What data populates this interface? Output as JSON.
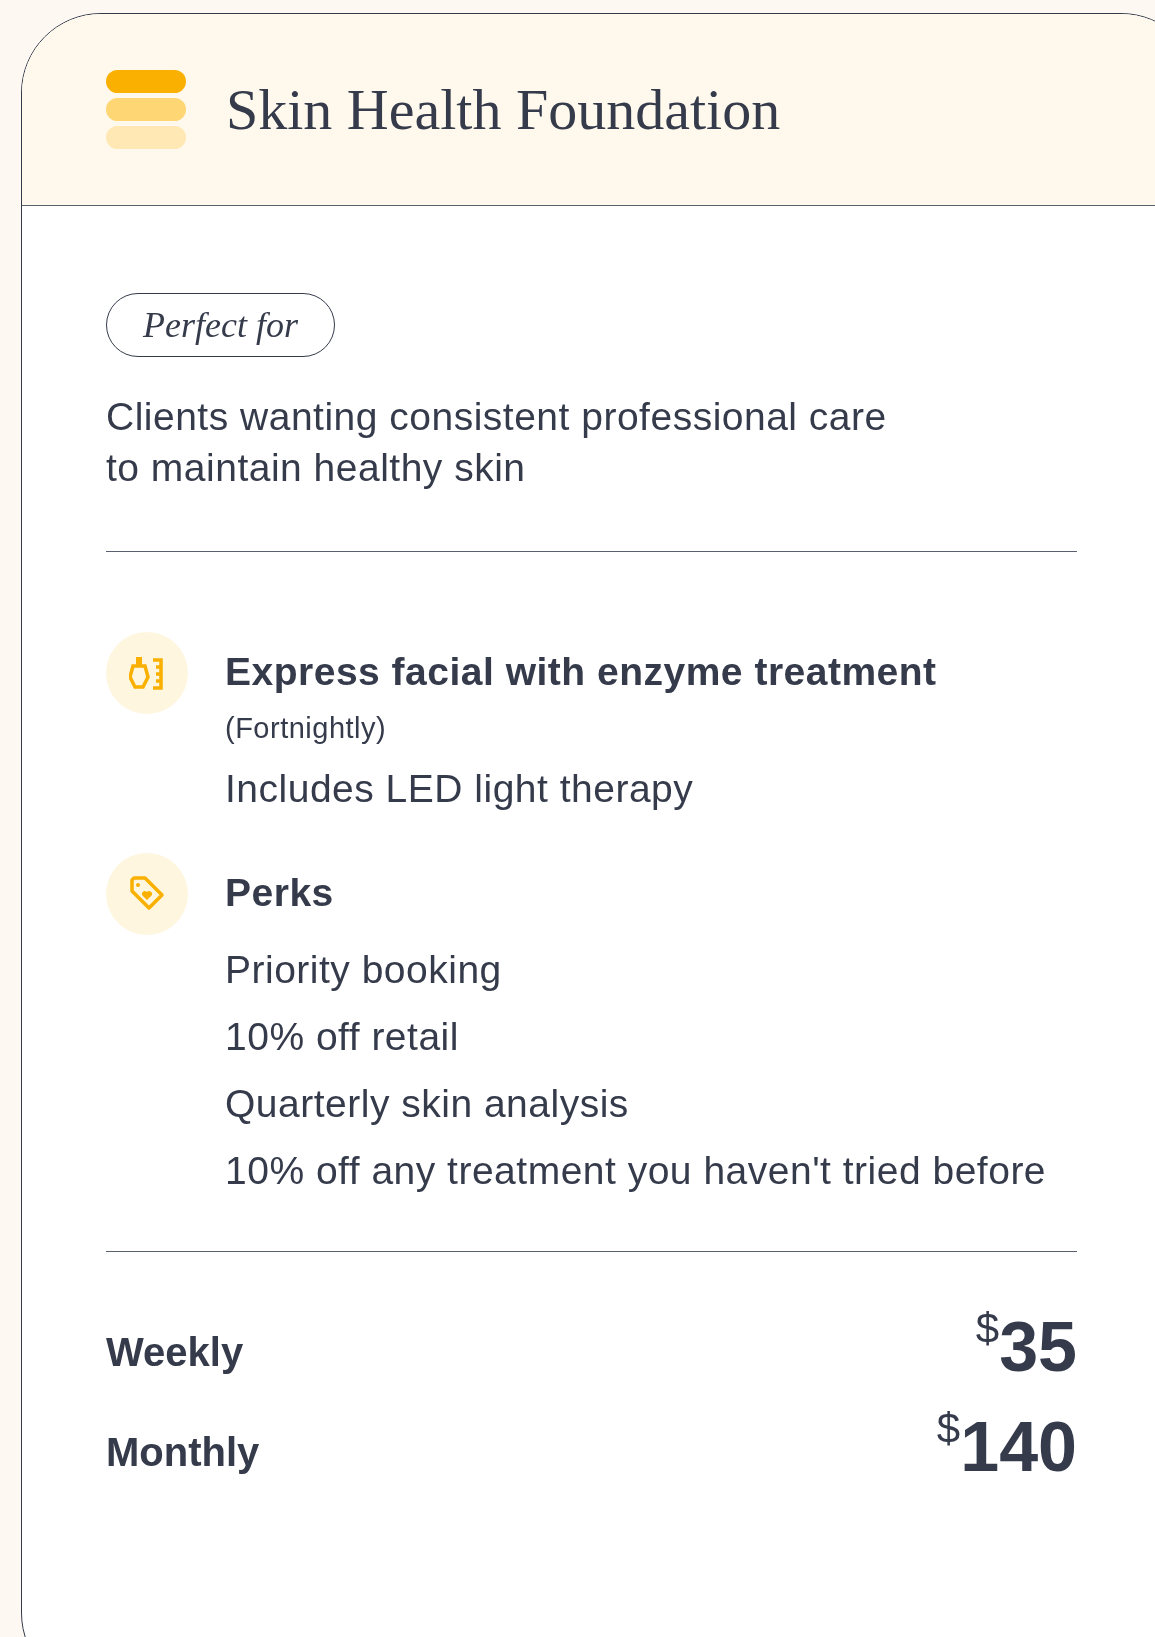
{
  "header": {
    "title": "Skin Health Foundation"
  },
  "audience": {
    "tag": "Perfect for",
    "description": "Clients wanting consistent professional care to maintain healthy skin"
  },
  "features": [
    {
      "kind": "treatment",
      "title": "Express facial with enzyme treatment",
      "frequency": "(Fortnightly)",
      "items": [
        "Includes LED light therapy"
      ]
    },
    {
      "kind": "perks",
      "title": "Perks",
      "items": [
        "Priority booking",
        "10% off retail",
        "Quarterly skin analysis",
        "10% off any treatment you haven't tried before"
      ]
    }
  ],
  "prices": [
    {
      "period": "Weekly",
      "currency": "$",
      "amount": "35"
    },
    {
      "period": "Monthly",
      "currency": "$",
      "amount": "140"
    }
  ]
}
